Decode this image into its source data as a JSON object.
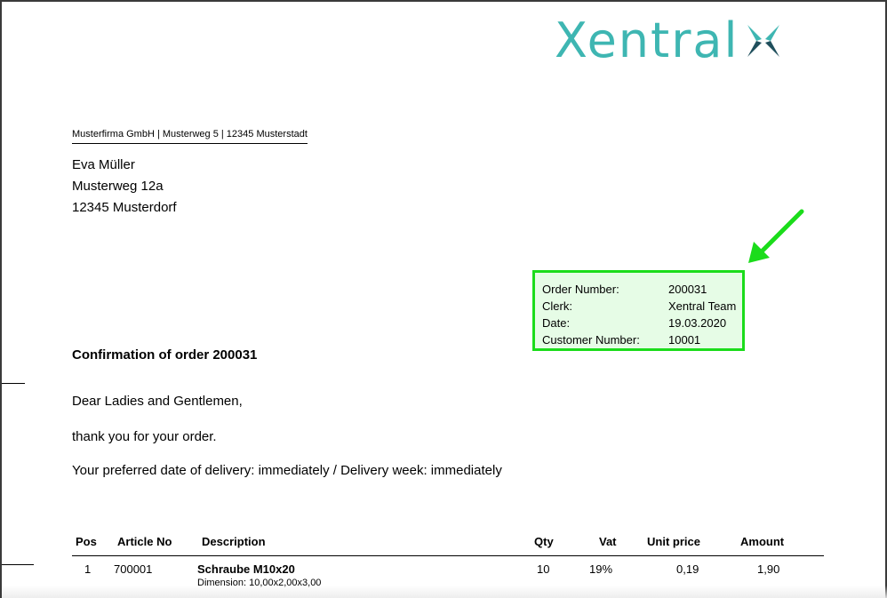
{
  "logo": {
    "text": "Xentral",
    "accent": "#3eb6b2",
    "mark": "xentral-x-logo-mark"
  },
  "sender_line": "Musterfirma GmbH | Musterweg 5 | 12345 Musterstadt",
  "recipient": {
    "name": "Eva Müller",
    "street": "Musterweg 12a",
    "city": "12345 Musterdorf"
  },
  "info": {
    "highlight_color": "#1bdc1b",
    "rows": [
      {
        "label": "Order Number:",
        "value": "200031"
      },
      {
        "label": "Clerk:",
        "value": "Xentral Team"
      },
      {
        "label": "Date:",
        "value": "19.03.2020"
      },
      {
        "label": "Customer Number:",
        "value": "10001"
      }
    ]
  },
  "subject": "Confirmation of order 200031",
  "greeting": "Dear Ladies and Gentlemen,",
  "thanks": "thank you for your order.",
  "delivery": "Your preferred date of delivery: immediately / Delivery week: immediately",
  "table": {
    "headers": {
      "pos": "Pos",
      "article": "Article No",
      "description": "Description",
      "qty": "Qty",
      "vat": "Vat",
      "unit_price": "Unit price",
      "amount": "Amount"
    },
    "rows": [
      {
        "pos": "1",
        "article": "700001",
        "description": "Schraube M10x20",
        "detail": "Dimension: 10,00x2,00x3,00",
        "qty": "10",
        "vat": "19%",
        "unit_price": "0,19",
        "amount": "1,90"
      }
    ]
  }
}
